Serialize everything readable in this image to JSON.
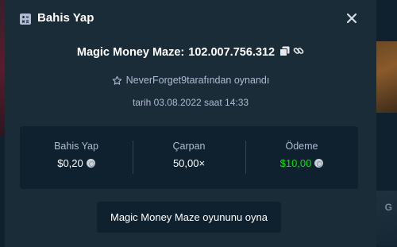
{
  "modal": {
    "title": "Bahis Yap",
    "game_name": "Magic Money Maze:",
    "bet_id": "102.007.756.312",
    "player_name": "NeverForget9",
    "player_suffix": "tarafından oynandı",
    "date_text": "tarih 03.08.2022 saat 14:33"
  },
  "stats": [
    {
      "label": "Bahis Yap",
      "value": "$0,20",
      "currency_icon": true,
      "highlight": false
    },
    {
      "label": "Çarpan",
      "value": "50,00×",
      "currency_icon": false,
      "highlight": false
    },
    {
      "label": "Ödeme",
      "value": "$10,00",
      "currency_icon": true,
      "highlight": true
    }
  ],
  "play_button": {
    "label": "Magic Money Maze oyununu oyna"
  },
  "background": {
    "right_letter": "G"
  },
  "colors": {
    "panel": "#1a2c38",
    "inset": "#0f212e",
    "text": "#ffffff",
    "muted": "#b1bad3",
    "win": "#00e701"
  },
  "icons": [
    "bet-slip-icon",
    "close-icon",
    "copy-icon",
    "link-icon",
    "star-icon",
    "coin-icon"
  ]
}
